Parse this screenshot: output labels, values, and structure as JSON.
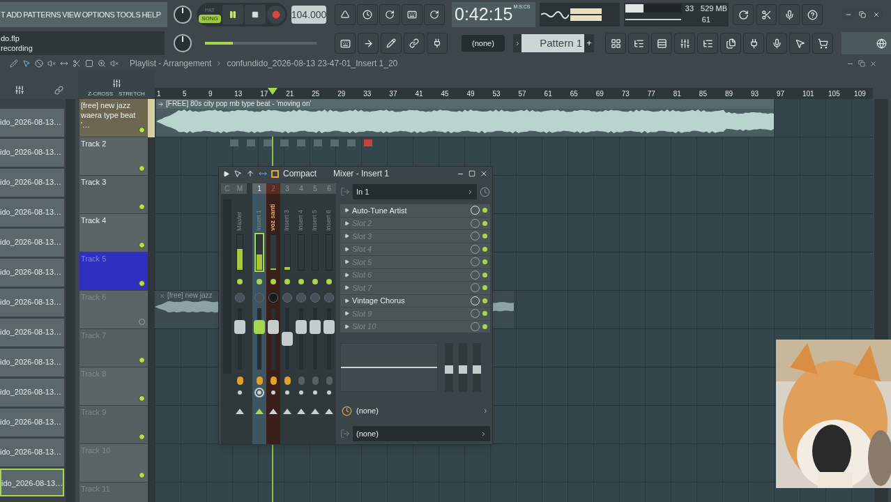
{
  "menu": {
    "items": [
      "T",
      "ADD",
      "PATTERNS",
      "VIEW",
      "OPTIONS",
      "TOOLS",
      "HELP"
    ]
  },
  "transport": {
    "modes": [
      {
        "label": "PAT",
        "selected": false
      },
      {
        "label": "SONG",
        "selected": true
      }
    ],
    "playing": true,
    "tempo": "104.000"
  },
  "hint_panel": {
    "lines": [
      "do.flp",
      "recording"
    ]
  },
  "master_pitch": {
    "level": 0.25
  },
  "time": {
    "value": "0:42:15",
    "format": "M:S:CS"
  },
  "monitor": {
    "cpu": {
      "level": 0.32,
      "reading": "33"
    },
    "memory": "529 MB",
    "polyphony": "61"
  },
  "pattern": {
    "channel": "(none)",
    "name": "Pattern 1",
    "add": "+"
  },
  "playlist": {
    "title": "Playlist - Arrangement",
    "path": "confundido_2026-08-13 23-47-01_Insert 1_20",
    "tool_labels": [
      "Z-CROSS",
      "STRETCH"
    ],
    "ruler": [
      "1",
      "5",
      "9",
      "13",
      "17",
      "21",
      "25",
      "29",
      "33",
      "37",
      "41",
      "45",
      "49",
      "53",
      "57",
      "61",
      "65",
      "69",
      "73",
      "77",
      "81",
      "85",
      "89",
      "93",
      "97",
      "101",
      "105",
      "109"
    ],
    "tracks": [
      {
        "name": "[free] new jazz waera type beat '…",
        "selected": false,
        "dimmed": false,
        "enabled": true
      },
      {
        "name": "Track 2",
        "selected": false,
        "dimmed": false,
        "enabled": true
      },
      {
        "name": "Track 3",
        "selected": false,
        "dimmed": false,
        "enabled": true
      },
      {
        "name": "Track 4",
        "selected": false,
        "dimmed": false,
        "enabled": true
      },
      {
        "name": "Track 5",
        "selected": true,
        "dimmed": false,
        "enabled": true
      },
      {
        "name": "Track 6",
        "selected": false,
        "dimmed": true,
        "enabled": false
      },
      {
        "name": "Track 7",
        "selected": false,
        "dimmed": true,
        "enabled": true
      },
      {
        "name": "Track 8",
        "selected": false,
        "dimmed": true,
        "enabled": true
      },
      {
        "name": "Track 9",
        "selected": false,
        "dimmed": true,
        "enabled": true
      },
      {
        "name": "Track 10",
        "selected": false,
        "dimmed": true,
        "enabled": true
      },
      {
        "name": "Track 11",
        "selected": false,
        "dimmed": true
      }
    ],
    "clips": [
      {
        "title": "[FREE] 80s city pop  rnb type beat - 'moving on'"
      },
      {
        "title": "[free] new jazz"
      }
    ]
  },
  "browser": {
    "items": [
      {
        "label": "ido_2026-08-13…",
        "selected": false
      },
      {
        "label": "ido_2026-08-13…",
        "selected": false
      },
      {
        "label": "ido_2026-08-13…",
        "selected": false
      },
      {
        "label": "ido_2026-08-13…",
        "selected": false
      },
      {
        "label": "ido_2026-08-13…",
        "selected": false
      },
      {
        "label": "ido_2026-08-13…",
        "selected": false
      },
      {
        "label": "ido_2026-08-13…",
        "selected": false
      },
      {
        "label": "ido_2026-08-13…",
        "selected": false
      },
      {
        "label": "ido_2026-08-13…",
        "selected": false
      },
      {
        "label": "ido_2026-08-13…",
        "selected": false
      },
      {
        "label": "ido_2026-08-13…",
        "selected": false
      },
      {
        "label": "ido_2026-08-13…",
        "selected": false
      },
      {
        "label": "ido_2026-08-13…",
        "selected": true
      }
    ]
  },
  "mixer": {
    "compact": "Compact",
    "title": "Mixer - Insert 1",
    "scale_label": "C",
    "channels": [
      {
        "number": "M",
        "name": "Master",
        "selected": false,
        "armed": false,
        "meter": {
          "level": 0.6
        },
        "fader": {
          "level": 0.75
        }
      },
      {
        "number": "1",
        "name": "Insert 1",
        "selected": true,
        "armed": false,
        "meter": {
          "level": 0.45
        },
        "fader": {
          "level": 0.75
        }
      },
      {
        "number": "2",
        "name": "voz santi",
        "selected": false,
        "armed": true,
        "meter": {
          "level": 0.05
        },
        "fader": {
          "level": 0.75
        }
      },
      {
        "number": "3",
        "name": "Insert 3",
        "selected": false,
        "armed": false,
        "meter": {
          "level": 0.08
        },
        "fader": {
          "level": 0.5
        }
      },
      {
        "number": "4",
        "name": "Insert 4",
        "selected": false,
        "armed": false,
        "fader": {
          "level": 0.75
        }
      },
      {
        "number": "5",
        "name": "Insert 5",
        "selected": false,
        "armed": false,
        "fader": {
          "level": 0.75
        }
      },
      {
        "number": "6",
        "name": "Insert 6",
        "selected": false,
        "armed": false,
        "fader": {
          "level": 0.75
        }
      }
    ],
    "input": "In 1",
    "slots": [
      {
        "name": "Auto-Tune Artist",
        "kind": "plugin"
      },
      {
        "name": "Slot 2",
        "kind": "empty"
      },
      {
        "name": "Slot 3",
        "kind": "empty"
      },
      {
        "name": "Slot 4",
        "kind": "empty"
      },
      {
        "name": "Slot 5",
        "kind": "empty"
      },
      {
        "name": "Slot 6",
        "kind": "empty"
      },
      {
        "name": "Slot 7",
        "kind": "empty"
      },
      {
        "name": "Vintage Chorus",
        "kind": "plugin"
      },
      {
        "name": "Slot 9",
        "kind": "empty"
      },
      {
        "name": "Slot 10",
        "kind": "empty"
      }
    ],
    "eq_bands": [
      {
        "level": 0.45
      },
      {
        "level": 0.45
      },
      {
        "level": 0.45
      }
    ],
    "sidechain": "(none)",
    "output": "(none)"
  }
}
